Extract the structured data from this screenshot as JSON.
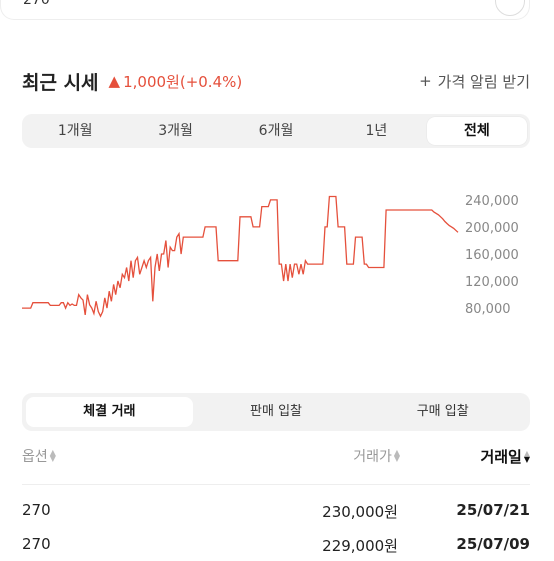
{
  "top": {
    "selected": "270"
  },
  "price": {
    "title": "최근 시세",
    "change_arrow": "▲",
    "change_text": "1,000원(+0.4%)",
    "alert_icon": "+",
    "alert_label": "가격 알림 받기",
    "accent": "#e5503c"
  },
  "periods": [
    "1개월",
    "3개월",
    "6개월",
    "1년",
    "전체"
  ],
  "active_period": "전체",
  "chart_data": {
    "type": "line",
    "title": "",
    "xlabel": "",
    "ylabel": "",
    "y_ticks": [
      "240,000",
      "200,000",
      "160,000",
      "120,000",
      "80,000"
    ],
    "ylim": [
      55000,
      262000
    ],
    "grid": false,
    "color": "#e5503c",
    "x": [
      0,
      1,
      2,
      3,
      4,
      5,
      6,
      7,
      8,
      9,
      10,
      11,
      12,
      13,
      14,
      15,
      16,
      17,
      18,
      19,
      20,
      21,
      22,
      23,
      24,
      25,
      26,
      27,
      28,
      29,
      30,
      31,
      32,
      33,
      34,
      35,
      36,
      37,
      38,
      39,
      40,
      41,
      42,
      43,
      44,
      45,
      46,
      47,
      48,
      49,
      50,
      51,
      52,
      53,
      54,
      55,
      56,
      57,
      58,
      59,
      60,
      61,
      62,
      63,
      64,
      65,
      66,
      67,
      68,
      69,
      70,
      71,
      72,
      73,
      74,
      75,
      76,
      77,
      78,
      79,
      80,
      81,
      82,
      83,
      84,
      85,
      86,
      87,
      88,
      89,
      90,
      91,
      92,
      93,
      94,
      95,
      96,
      97,
      98,
      99,
      100,
      101,
      102,
      103,
      104,
      105,
      106,
      107,
      108,
      109,
      110,
      111,
      112,
      113,
      114,
      115,
      116,
      117,
      118,
      119,
      120,
      121,
      122,
      123,
      124,
      125,
      126,
      127,
      128,
      129,
      130,
      131,
      132,
      133,
      134,
      135,
      136,
      137,
      138,
      139,
      140,
      141,
      142,
      143,
      144,
      145,
      146,
      147,
      148,
      149,
      150,
      151,
      152,
      153,
      154,
      155,
      156,
      157,
      158,
      159,
      160,
      161,
      162,
      163,
      164,
      165,
      166,
      167,
      168,
      169,
      170,
      171,
      172,
      173,
      174,
      175,
      176,
      177,
      178,
      179,
      180,
      181,
      182,
      183,
      184,
      185,
      186,
      187,
      188,
      189,
      190,
      191,
      192,
      193,
      194,
      195,
      196,
      197,
      198,
      199,
      200
    ],
    "values": [
      80000,
      80000,
      80000,
      80000,
      80000,
      88000,
      88000,
      88000,
      88000,
      88000,
      88000,
      88000,
      88000,
      84000,
      84000,
      84000,
      84000,
      84000,
      88000,
      88000,
      80000,
      88000,
      84000,
      86000,
      84000,
      84000,
      100000,
      95000,
      92000,
      70000,
      100000,
      85000,
      80000,
      72000,
      90000,
      75000,
      68000,
      75000,
      95000,
      80000,
      105000,
      90000,
      115000,
      100000,
      120000,
      110000,
      130000,
      125000,
      140000,
      120000,
      150000,
      125000,
      150000,
      155000,
      130000,
      140000,
      150000,
      140000,
      150000,
      155000,
      90000,
      140000,
      160000,
      135000,
      160000,
      160000,
      180000,
      140000,
      170000,
      165000,
      165000,
      185000,
      190000,
      160000,
      185000,
      185000,
      185000,
      185000,
      185000,
      185000,
      185000,
      185000,
      185000,
      185000,
      200000,
      200000,
      200000,
      200000,
      200000,
      200000,
      150000,
      150000,
      150000,
      150000,
      150000,
      150000,
      150000,
      150000,
      150000,
      150000,
      215000,
      215000,
      215000,
      215000,
      215000,
      215000,
      200000,
      200000,
      200000,
      200000,
      230000,
      230000,
      230000,
      230000,
      240000,
      240000,
      240000,
      240000,
      145000,
      145000,
      120000,
      145000,
      120000,
      145000,
      125000,
      145000,
      145000,
      130000,
      145000,
      130000,
      150000,
      145000,
      145000,
      145000,
      145000,
      145000,
      145000,
      145000,
      145000,
      200000,
      200000,
      245000,
      245000,
      245000,
      245000,
      200000,
      200000,
      200000,
      200000,
      145000,
      145000,
      145000,
      145000,
      185000,
      185000,
      185000,
      185000,
      145000,
      145000,
      140000,
      140000,
      140000,
      140000,
      140000,
      140000,
      140000,
      140000,
      225000,
      225000,
      225000,
      225000,
      225000,
      225000,
      225000,
      225000,
      225000,
      225000,
      225000,
      225000,
      225000,
      225000,
      225000,
      225000,
      225000,
      225000,
      225000,
      225000,
      225000,
      225000,
      222000,
      220000,
      218000,
      215000,
      212000,
      208000,
      205000,
      202000,
      200000,
      198000,
      195000,
      192000,
      190000,
      188000,
      230000
    ]
  },
  "trade_tabs": [
    "체결 거래",
    "판매 입찰",
    "구매 입찰"
  ],
  "active_trade_tab": "체결 거래",
  "table": {
    "headers": {
      "option": "옵션",
      "price": "거래가",
      "date": "거래일"
    },
    "rows": [
      {
        "option": "270",
        "price": "230,000원",
        "date": "25/07/21"
      },
      {
        "option": "270",
        "price": "229,000원",
        "date": "25/07/09"
      }
    ]
  }
}
